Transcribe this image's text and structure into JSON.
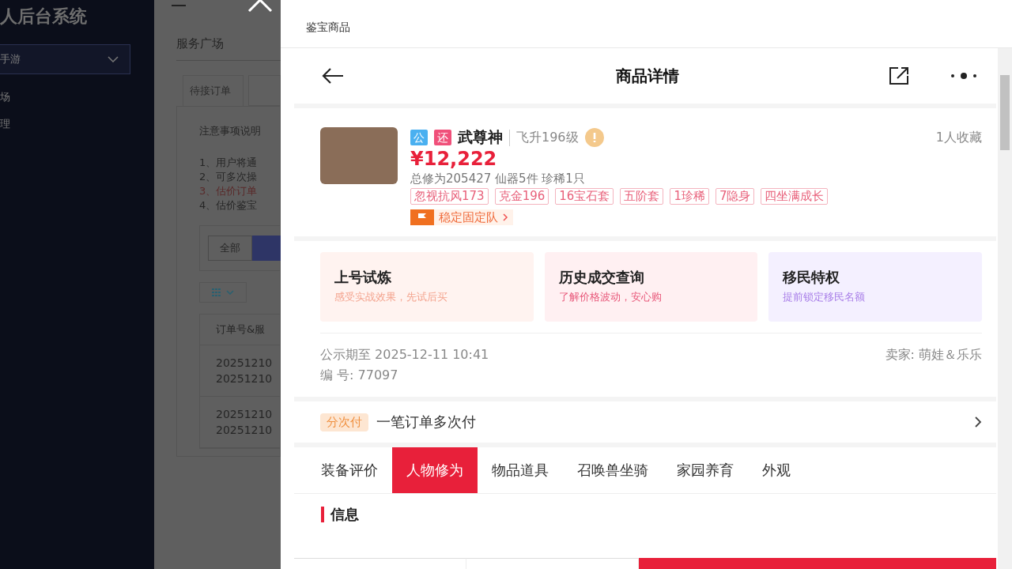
{
  "background": {
    "system_title": "人后台系统",
    "game_select": "手游",
    "sidebar_items": [
      "场",
      "理"
    ],
    "page_title": "服务广场",
    "tab": "待接订单",
    "notice_title": "注意事项说明",
    "notices": [
      {
        "text": "1、用户将通",
        "highlight": false
      },
      {
        "text": "2、可多次操",
        "highlight": false
      },
      {
        "text": "3、估价订单",
        "highlight": true
      },
      {
        "text": "4、估价鉴宝",
        "highlight": false
      }
    ],
    "filter_button": "全部",
    "table_header": "订单号&服",
    "rows": [
      [
        "20251210",
        "20251210"
      ],
      [
        "20251210",
        "20251210"
      ]
    ]
  },
  "drawer": {
    "title": "鉴宝商品"
  },
  "detail": {
    "nav_title": "商品详情",
    "product": {
      "badges": [
        {
          "text": "公",
          "color": "#4ab0f0"
        },
        {
          "text": "还",
          "color": "#f0507a"
        }
      ],
      "name": "武尊神",
      "level": "飞升196级",
      "favorites": "1人收藏",
      "price": "¥12,222",
      "stats": "总修为205427  仙器5件  珍稀1只",
      "tags": [
        "忽视抗风173",
        "克金196",
        "16宝石套",
        "五阶套",
        "1珍稀",
        "7隐身",
        "四坐满成长"
      ],
      "team": "稳定固定队"
    },
    "promos": [
      {
        "title": "上号试炼",
        "subtitle": "感受实战效果，先试后买",
        "color": "#f4a48f"
      },
      {
        "title": "历史成交查询",
        "subtitle": "了解价格波动，安心购",
        "color": "#e8587a"
      },
      {
        "title": "移民特权",
        "subtitle": "提前锁定移民名额",
        "color": "#a87ee8"
      }
    ],
    "public_until": "公示期至 2025-12-11 10:41",
    "seller": "卖家: 萌娃＆乐乐",
    "serial": "编 号: 77097",
    "pay": {
      "badge": "分次付",
      "text": "一笔订单多次付"
    },
    "tabs": [
      {
        "label": "装备评价",
        "selected": false
      },
      {
        "label": "人物修为",
        "selected": true
      },
      {
        "label": "物品道具",
        "selected": false
      },
      {
        "label": "召唤兽坐骑",
        "selected": false
      },
      {
        "label": "家园养育",
        "selected": false
      },
      {
        "label": "外观",
        "selected": false
      }
    ],
    "section_title": "信息"
  }
}
